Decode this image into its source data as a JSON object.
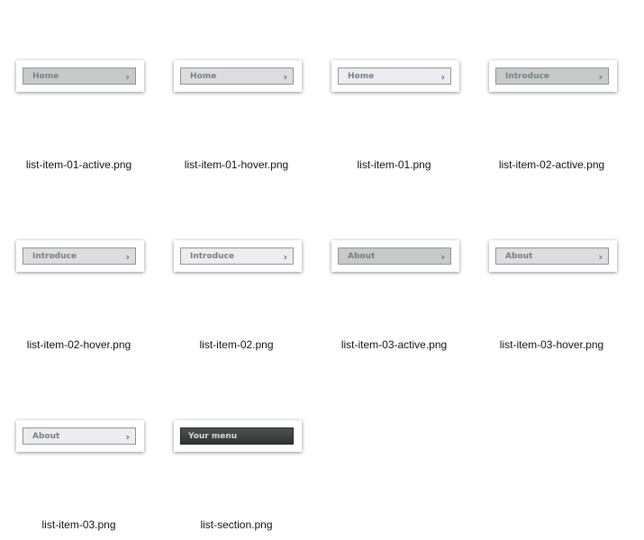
{
  "files": [
    {
      "label": "Home",
      "state": "active",
      "filename": "list-item-01-active.png"
    },
    {
      "label": "Home",
      "state": "hover",
      "filename": "list-item-01-hover.png"
    },
    {
      "label": "Home",
      "state": "normal",
      "filename": "list-item-01.png"
    },
    {
      "label": "Introduce",
      "state": "active",
      "filename": "list-item-02-active.png"
    },
    {
      "label": "Introduce",
      "state": "hover",
      "filename": "list-item-02-hover.png"
    },
    {
      "label": "Introduce",
      "state": "normal",
      "filename": "list-item-02.png"
    },
    {
      "label": "About",
      "state": "active",
      "filename": "list-item-03-active.png"
    },
    {
      "label": "About",
      "state": "hover",
      "filename": "list-item-03-hover.png"
    },
    {
      "label": "About",
      "state": "normal",
      "filename": "list-item-03.png"
    },
    {
      "label": "Your menu",
      "state": "section",
      "filename": "list-section.png"
    }
  ],
  "icons": {
    "chevron": "chevron-right-icon"
  },
  "colors": {
    "active_fill": "#c5cbc9",
    "hover_fill": "#dcdce1",
    "normal_fill": "#ececf1",
    "section_fill": "#3d4241"
  }
}
